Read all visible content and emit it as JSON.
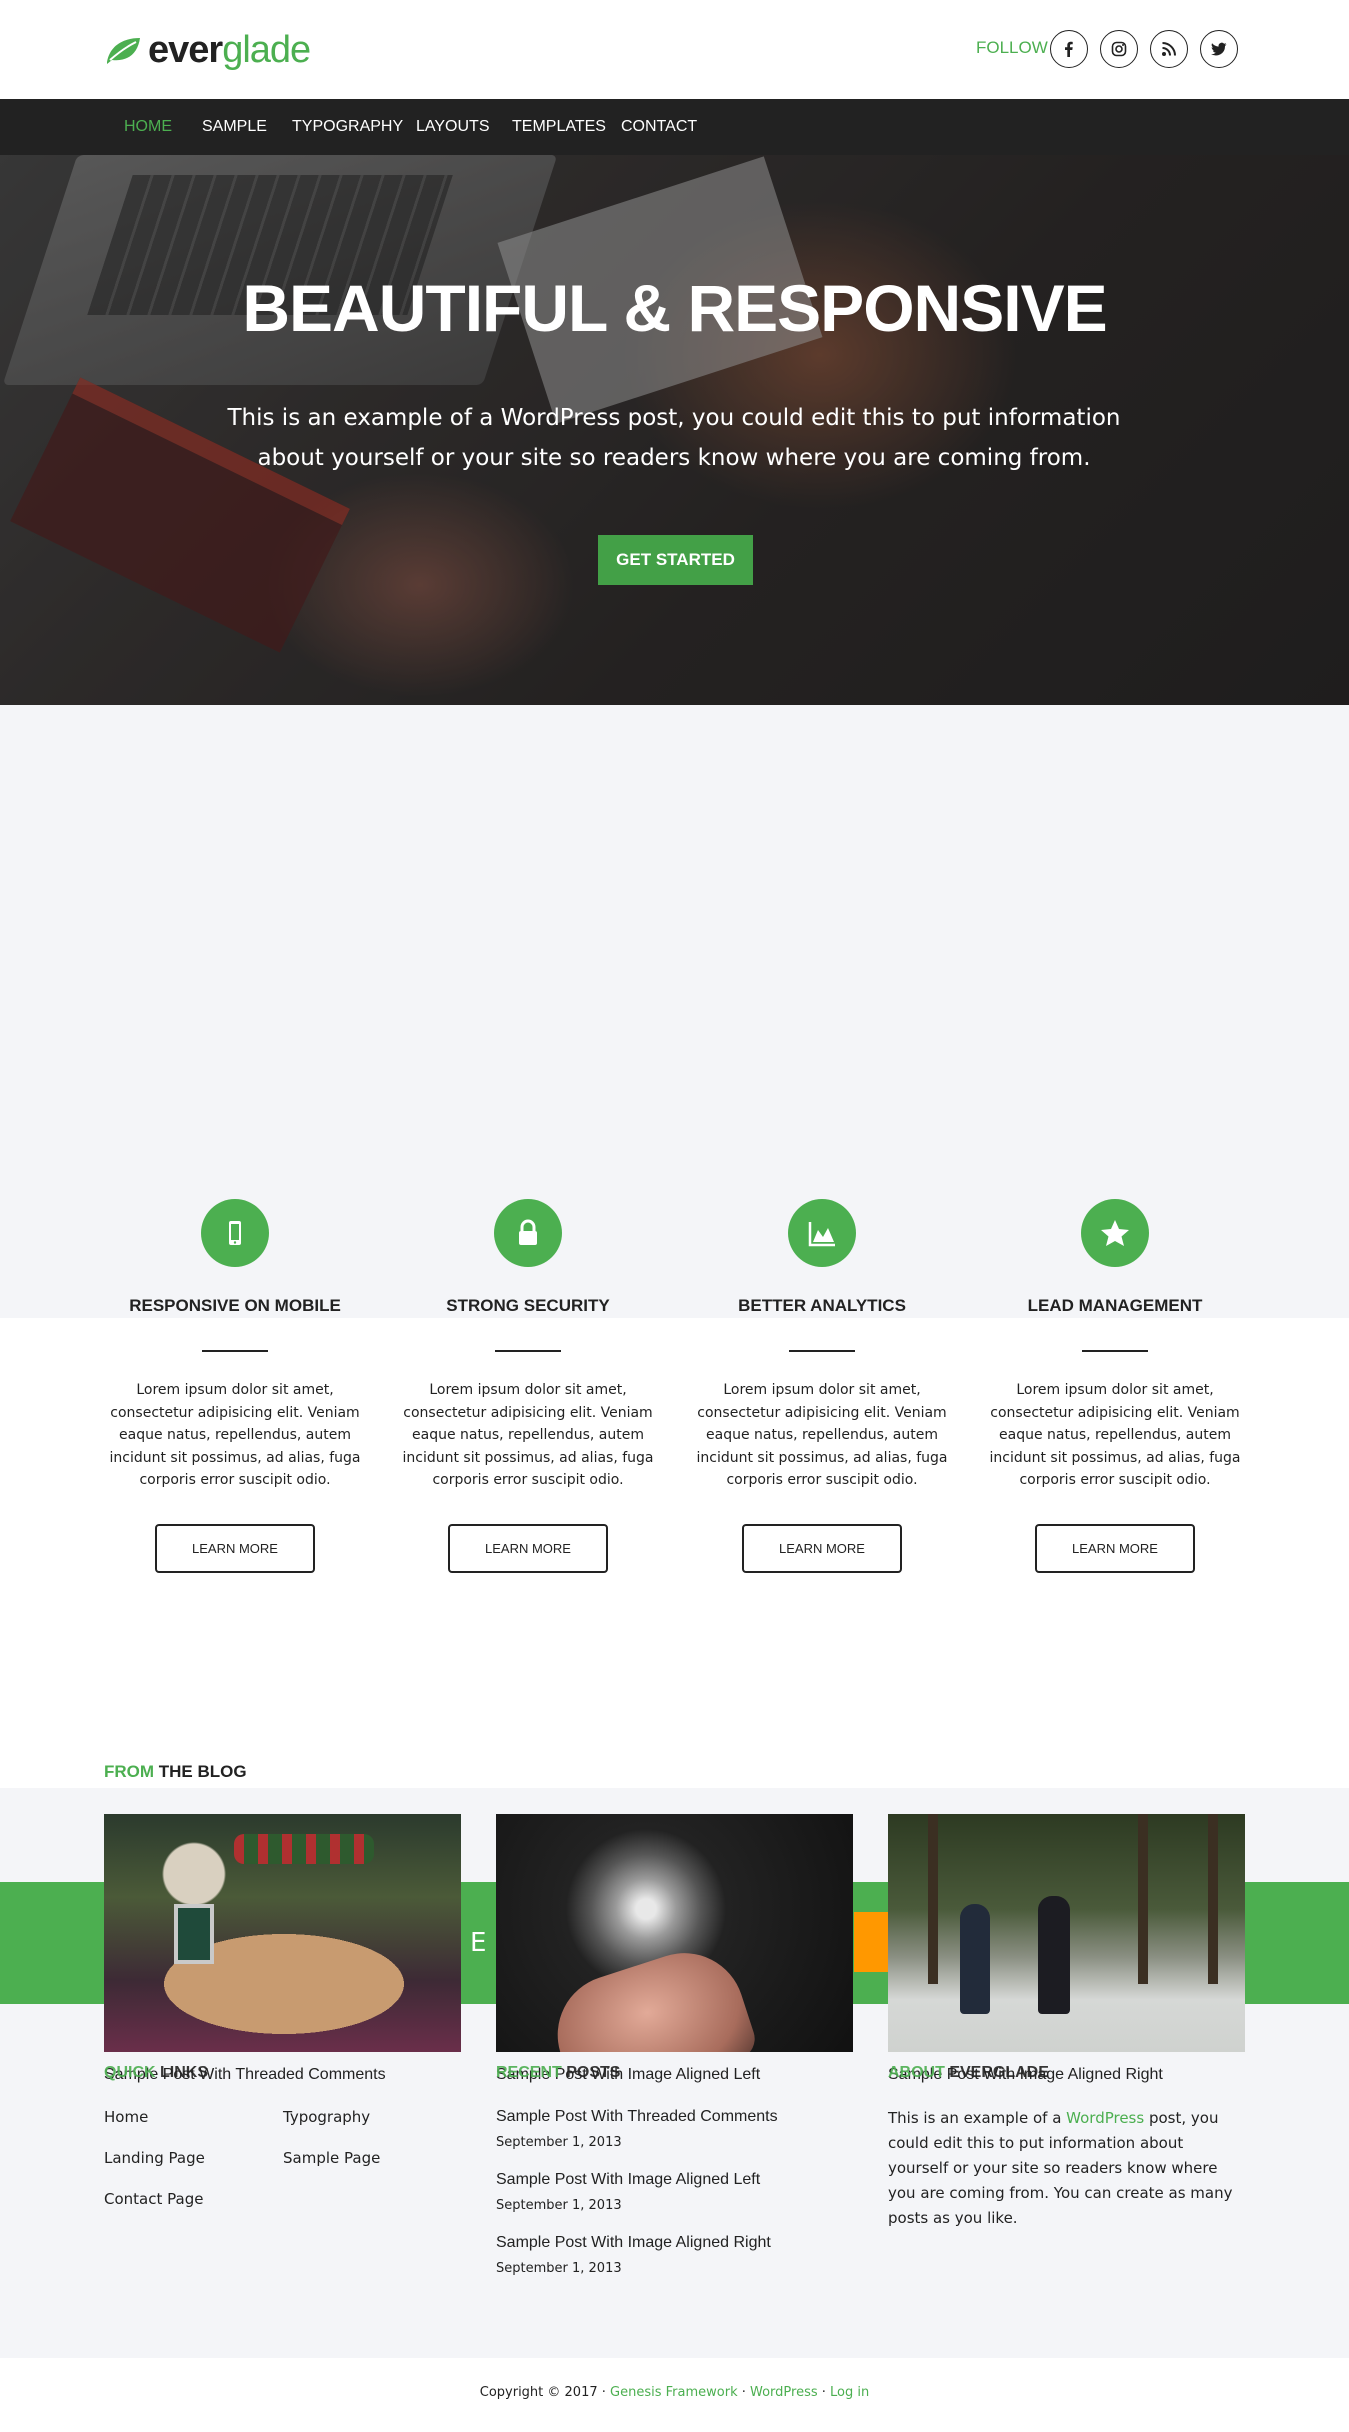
{
  "header": {
    "logo_part1": "ever",
    "logo_part2": "glade",
    "follow_label": "FOLLOW US",
    "social_icons": [
      "facebook-icon",
      "instagram-icon",
      "rss-icon",
      "twitter-icon"
    ]
  },
  "nav": {
    "items": [
      {
        "label": "HOME",
        "active": true
      },
      {
        "label": "SAMPLE"
      },
      {
        "label": "TYPOGRAPHY"
      },
      {
        "label": "LAYOUTS"
      },
      {
        "label": "TEMPLATES"
      },
      {
        "label": "CONTACT"
      }
    ]
  },
  "hero": {
    "title": "BEAUTIFUL & RESPONSIVE",
    "text": "This is an example of a WordPress post, you could edit this to put information about yourself or your site so readers know where you are coming from.",
    "button": "GET STARTED"
  },
  "features": [
    {
      "icon": "mobile-icon",
      "title": "RESPONSIVE ON MOBILE",
      "text": "Lorem ipsum dolor sit amet, consectetur adipisicing elit. Veniam eaque natus, repellendus, autem incidunt sit possimus, ad alias, fuga corporis error suscipit odio.",
      "button": "LEARN MORE"
    },
    {
      "icon": "lock-icon",
      "title": "STRONG SECURITY",
      "text": "Lorem ipsum dolor sit amet, consectetur adipisicing elit. Veniam eaque natus, repellendus, autem incidunt sit possimus, ad alias, fuga corporis error suscipit odio.",
      "button": "LEARN MORE"
    },
    {
      "icon": "area-chart-icon",
      "title": "BETTER ANALYTICS",
      "text": "Lorem ipsum dolor sit amet, consectetur adipisicing elit. Veniam eaque natus, repellendus, autem incidunt sit possimus, ad alias, fuga corporis error suscipit odio.",
      "button": "LEARN MORE"
    },
    {
      "icon": "star-icon",
      "title": "LEAD MANAGEMENT",
      "text": "Lorem ipsum dolor sit amet, consectetur adipisicing elit. Veniam eaque natus, repellendus, autem incidunt sit possimus, ad alias, fuga corporis error suscipit odio.",
      "button": "LEARN MORE"
    }
  ],
  "blog": {
    "heading_green": "FROM",
    "heading_rest": " THE BLOG",
    "band_text": "E T",
    "posts": [
      {
        "title": "Sample Post With Threaded Comments"
      },
      {
        "title": "Sample Post With Image Aligned Left"
      },
      {
        "title": "Sample Post With Image Aligned Right"
      }
    ]
  },
  "widgets": {
    "quick_links": {
      "title_green": "QUICK",
      "title_rest": " LINKS",
      "links": [
        "Home",
        "Typography",
        "Landing Page",
        "Sample Page",
        "Contact Page"
      ]
    },
    "recent_posts": {
      "title_green": "RECENT",
      "title_rest": " POSTS",
      "items": [
        {
          "title": "Sample Post With Threaded Comments",
          "date": "September 1, 2013"
        },
        {
          "title": "Sample Post With Image Aligned Left",
          "date": "September 1, 2013"
        },
        {
          "title": "Sample Post With Image Aligned Right",
          "date": "September 1, 2013"
        }
      ]
    },
    "about": {
      "title_green": "ABOUT",
      "title_rest": " EVERGLADE",
      "text_before": "This is an example of a ",
      "link": "WordPress",
      "text_after": " post, you could edit this to put information about yourself or your site so readers know where you are coming from. You can create as many posts as you like."
    }
  },
  "footer": {
    "copyright": "Copyright © 2017 · ",
    "link1": "Genesis Framework",
    "sep": " · ",
    "link2": "WordPress",
    "link3": "Log in"
  },
  "colors": {
    "accent": "#4caf50",
    "button_green": "#43a047",
    "nav_bg": "#222222",
    "orange": "#ff9800"
  }
}
